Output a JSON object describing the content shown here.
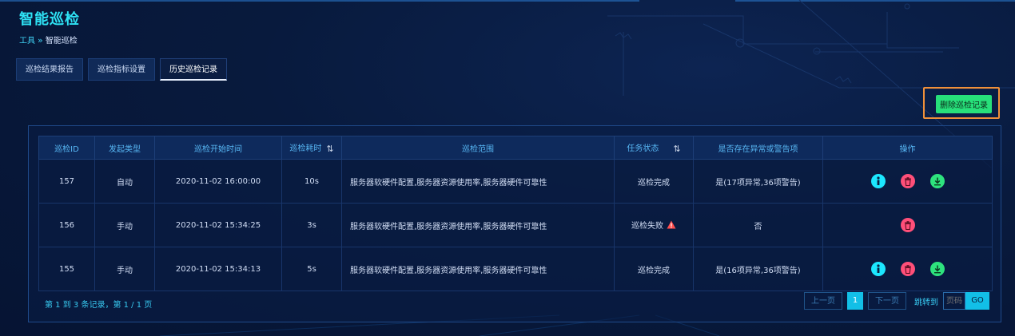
{
  "header": {
    "title": "智能巡检",
    "breadcrumb": {
      "root": "工具",
      "separator": "»",
      "current": "智能巡检"
    }
  },
  "tabs": [
    {
      "label": "巡检结果报告",
      "active": false
    },
    {
      "label": "巡检指标设置",
      "active": false
    },
    {
      "label": "历史巡检记录",
      "active": true
    }
  ],
  "toolbar": {
    "delete_label": "删除巡检记录"
  },
  "table": {
    "columns": [
      "巡检ID",
      "发起类型",
      "巡检开始时间",
      "巡检耗时",
      "巡检范围",
      "任务状态",
      "是否存在异常或警告项",
      "操作"
    ],
    "rows": [
      {
        "id": "157",
        "type": "自动",
        "start": "2020-11-02 16:00:00",
        "duration": "10s",
        "scope": "服务器软硬件配置,服务器资源使用率,服务器硬件可靠性",
        "status": "巡检完成",
        "anomaly": "是(17项异常,36项警告)",
        "actions": [
          "info",
          "delete",
          "download"
        ]
      },
      {
        "id": "156",
        "type": "手动",
        "start": "2020-11-02 15:34:25",
        "duration": "3s",
        "scope": "服务器软硬件配置,服务器资源使用率,服务器硬件可靠性",
        "status": "巡检失败",
        "anomaly": "否",
        "actions": [
          "delete"
        ]
      },
      {
        "id": "155",
        "type": "手动",
        "start": "2020-11-02 15:34:13",
        "duration": "5s",
        "scope": "服务器软硬件配置,服务器资源使用率,服务器硬件可靠性",
        "status": "巡检完成",
        "anomaly": "是(16项异常,36项警告)",
        "actions": [
          "info",
          "delete",
          "download"
        ]
      }
    ]
  },
  "pagination": {
    "summary": "第 1 到 3 条记录，第 1 / 1 页",
    "prev": "上一页",
    "current_page": "1",
    "next": "下一页",
    "jump_label": "跳转到",
    "page_placeholder": "页码",
    "go": "GO"
  },
  "colors": {
    "accent": "#12bfe7",
    "title": "#2ee3f5",
    "danger": "#ff4f79",
    "success": "#27e07a",
    "info": "#1ce7ff",
    "highlight": "#f0903a"
  },
  "icons": {
    "sort": "sort-icon",
    "warning": "warning-icon",
    "info": "info-icon",
    "delete": "trash-icon",
    "download": "download-icon"
  }
}
